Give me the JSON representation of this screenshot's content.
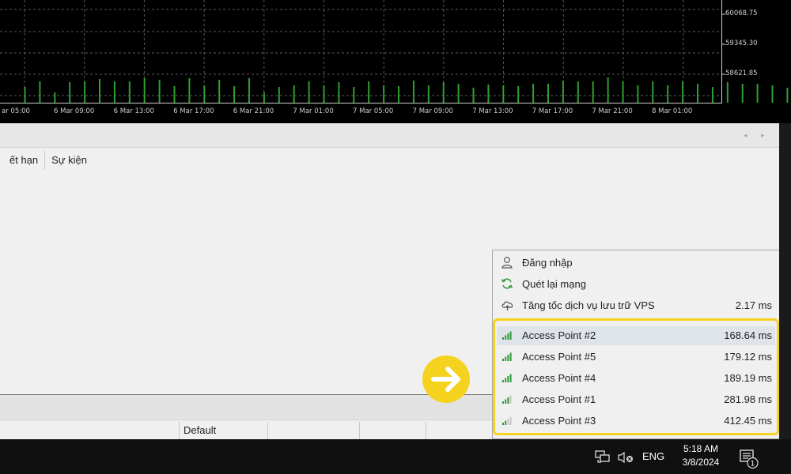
{
  "chart": {
    "x_ticks": [
      "ar 05:00",
      "6 Mar 09:00",
      "6 Mar 13:00",
      "6 Mar 17:00",
      "6 Mar 21:00",
      "7 Mar 01:00",
      "7 Mar 05:00",
      "7 Mar 09:00",
      "7 Mar 13:00",
      "7 Mar 17:00",
      "7 Mar 21:00",
      "8 Mar 01:00"
    ],
    "y_ticks": [
      "60068.75",
      "59345.30",
      "58621.85"
    ],
    "bar_color": "#2fa02f",
    "grid_color": "#5a5a5a"
  },
  "log_panel": {
    "columns": [
      "ết hạn",
      "Sự kiện"
    ]
  },
  "status_bar": {
    "profile": "Default"
  },
  "network_menu": {
    "actions": [
      {
        "icon": "user-icon",
        "label": "Đăng nhập",
        "ping": ""
      },
      {
        "icon": "refresh-icon",
        "label": "Quét lại mạng",
        "ping": ""
      },
      {
        "icon": "cloud-upload-icon",
        "label": "Tăng tốc dịch vụ lưu trữ VPS",
        "ping": "2.17 ms"
      }
    ],
    "access_points": [
      {
        "label": "Access Point #2",
        "ping": "168.64 ms",
        "signal": 4,
        "selected": true
      },
      {
        "label": "Access Point #5",
        "ping": "179.12 ms",
        "signal": 4,
        "selected": false
      },
      {
        "label": "Access Point #4",
        "ping": "189.19 ms",
        "signal": 4,
        "selected": false
      },
      {
        "label": "Access Point #1",
        "ping": "281.98 ms",
        "signal": 3,
        "selected": false
      },
      {
        "label": "Access Point #3",
        "ping": "412.45 ms",
        "signal": 2,
        "selected": false
      }
    ],
    "highlight_color": "#f5d21d"
  },
  "taskbar": {
    "language": "ENG",
    "time": "5:18 AM",
    "date": "3/8/2024",
    "notification_count": "1"
  }
}
